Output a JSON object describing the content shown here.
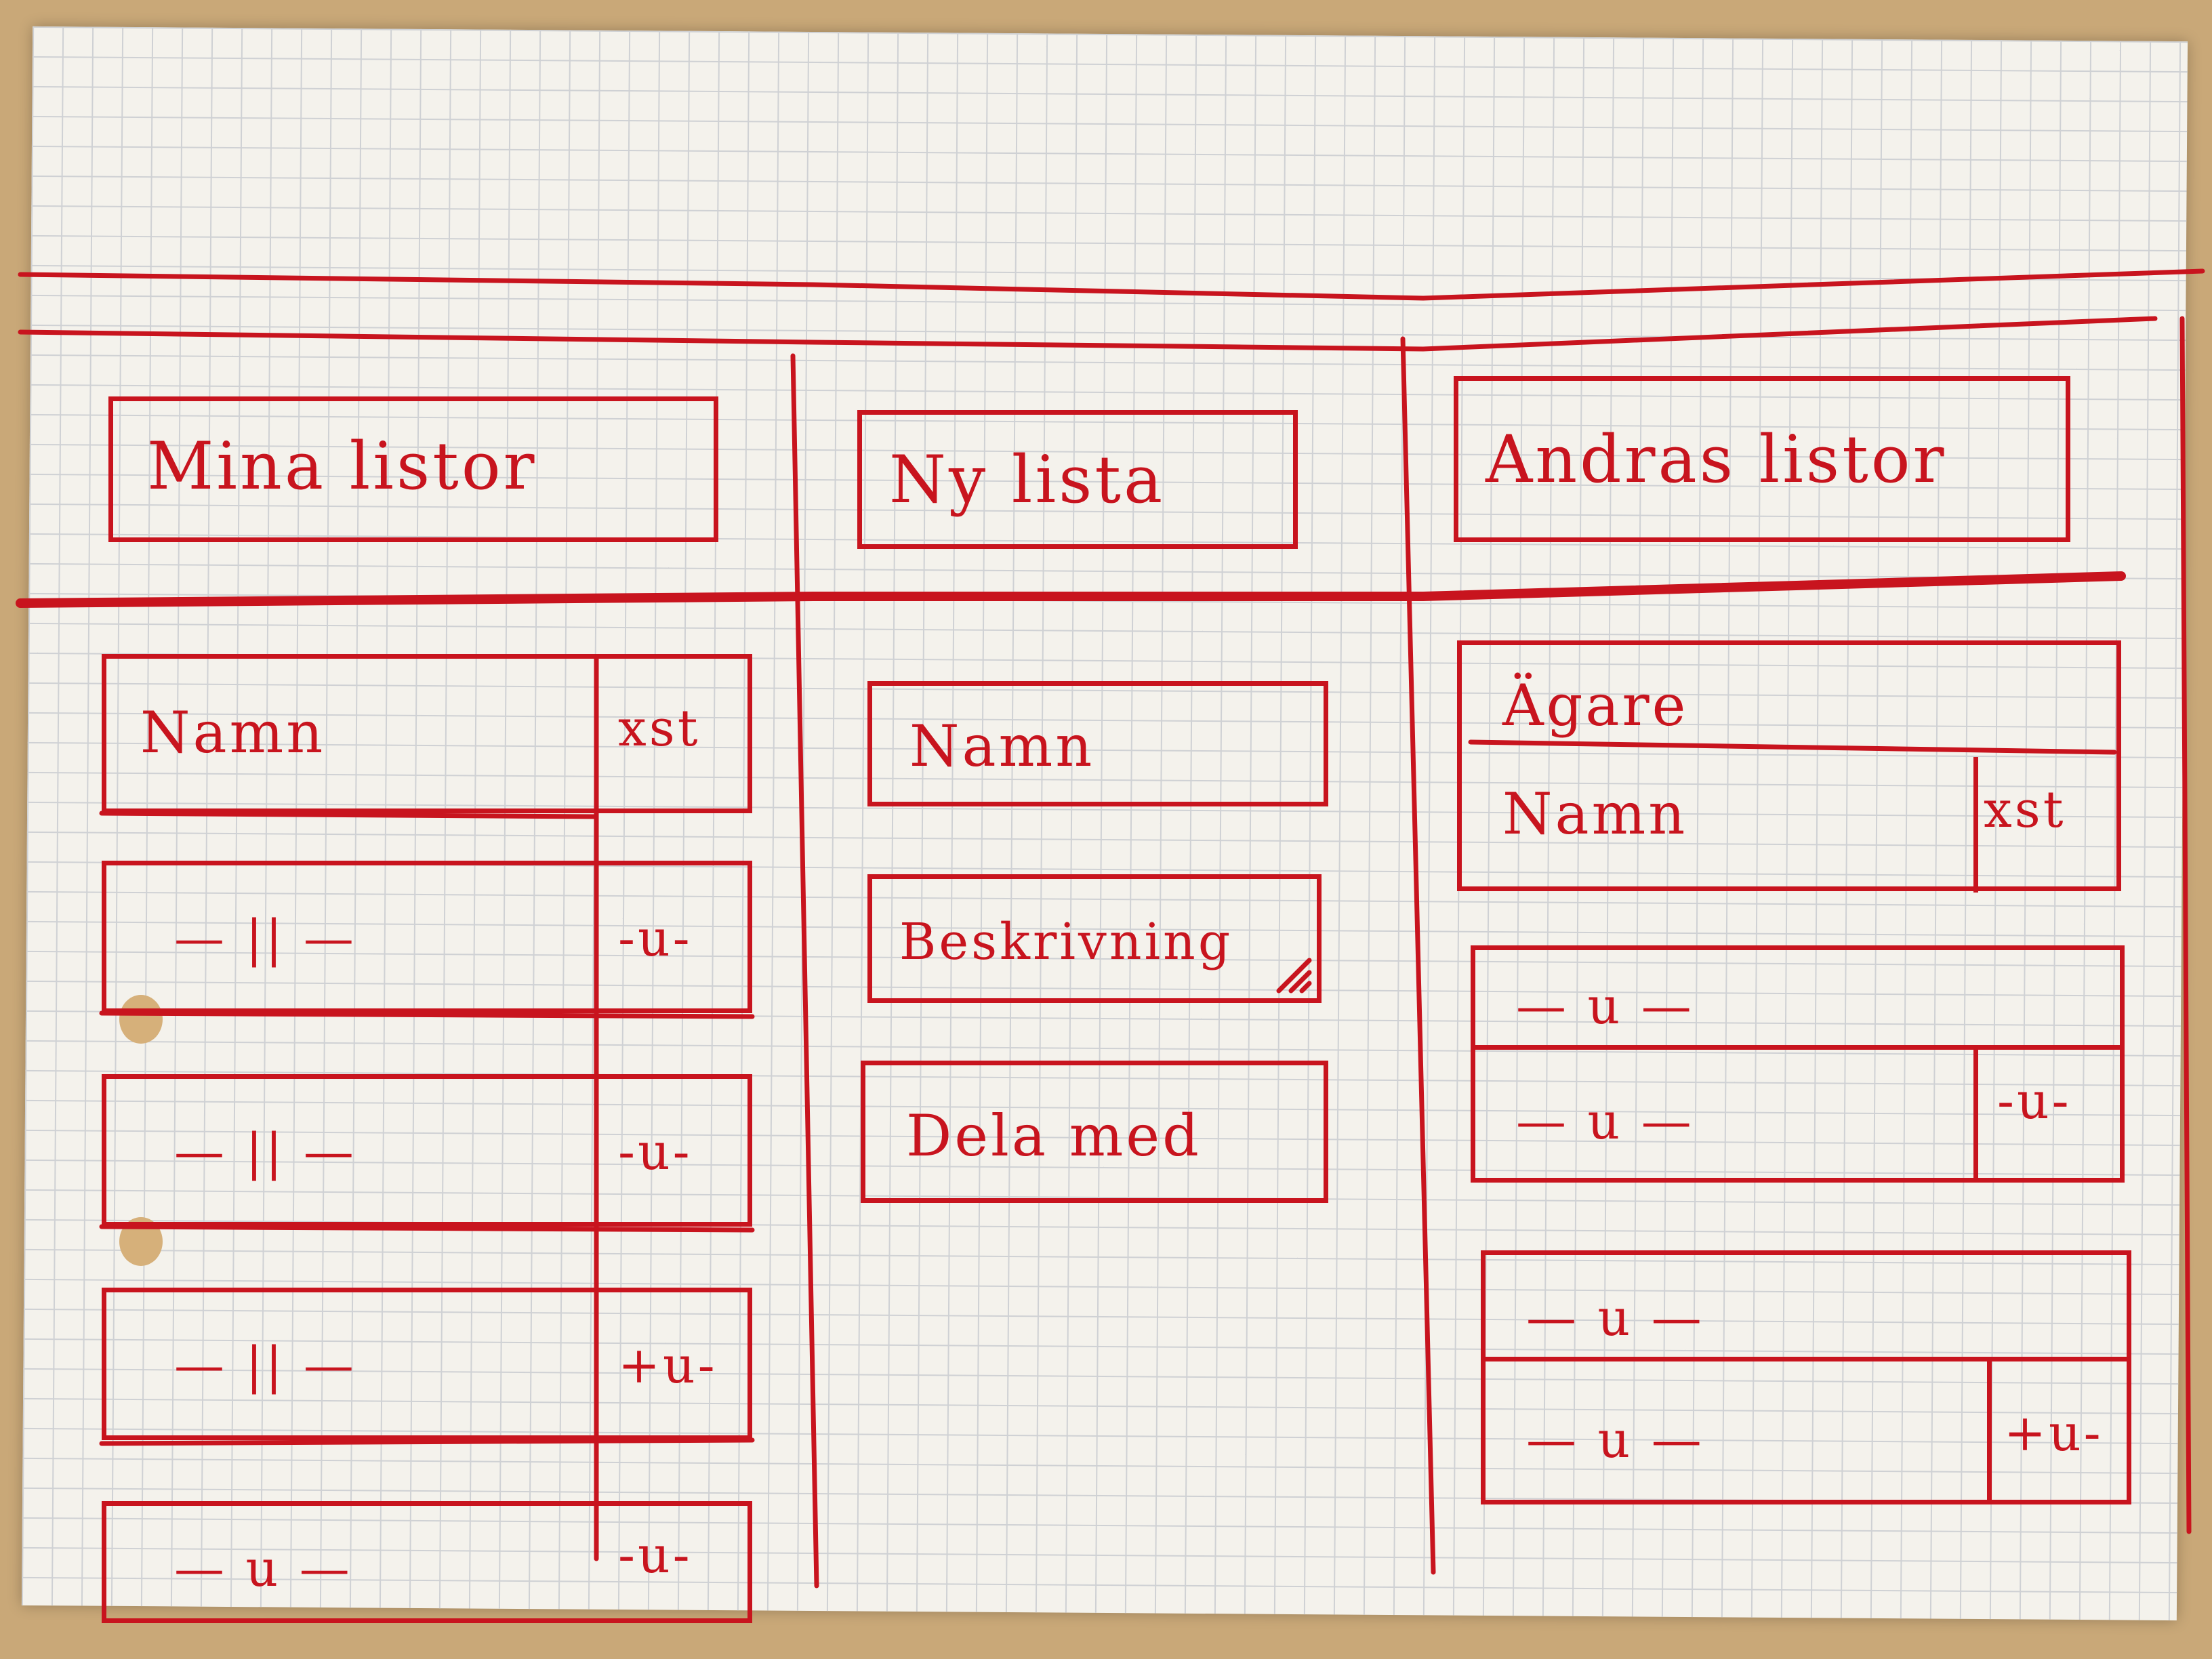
{
  "columns": {
    "mine": {
      "title": "Mina listor",
      "header": {
        "name": "Namn",
        "count": "xst"
      },
      "rows": [
        {
          "name": "— || —",
          "count": "-u-"
        },
        {
          "name": "— || —",
          "count": "-u-"
        },
        {
          "name": "— || —",
          "count": "+u-"
        },
        {
          "name": "— u —",
          "count": "-u-"
        }
      ]
    },
    "new": {
      "title": "Ny lista",
      "fields": {
        "name": "Namn",
        "description": "Beskrivning",
        "share": "Dela med"
      }
    },
    "others": {
      "title": "Andras listor",
      "owner": "Ägare",
      "header": {
        "name": "Namn",
        "count": "xst"
      },
      "groups": [
        {
          "owner": "— u —",
          "name": "— u —",
          "count": "-u-"
        },
        {
          "owner": "— u —",
          "name": "— u —",
          "count": "+u-"
        }
      ]
    }
  },
  "colors": {
    "ink": "#c8141e",
    "paper": "#f4f2ec",
    "grid": "#cfd1d4",
    "desk": "#c9a878"
  }
}
